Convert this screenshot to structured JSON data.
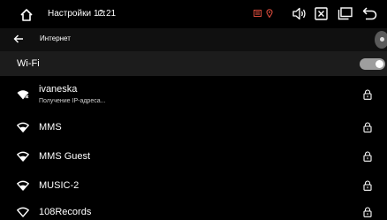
{
  "statusbar": {
    "title": "Настройки",
    "time": "12:21",
    "colors": {
      "notification": "#d64a3b",
      "icon": "#ffffff"
    }
  },
  "header": {
    "title": "Интернет"
  },
  "wifi": {
    "label": "Wi-Fi",
    "enabled": true
  },
  "networks": [
    {
      "name": "ivaneska",
      "status": "Получение IP-адреса...",
      "secured": true
    },
    {
      "name": "MMS",
      "status": "",
      "secured": true
    },
    {
      "name": "MMS Guest",
      "status": "",
      "secured": true
    },
    {
      "name": "MUSIC-2",
      "status": "",
      "secured": true
    },
    {
      "name": "108Records",
      "status": "",
      "secured": true
    }
  ]
}
